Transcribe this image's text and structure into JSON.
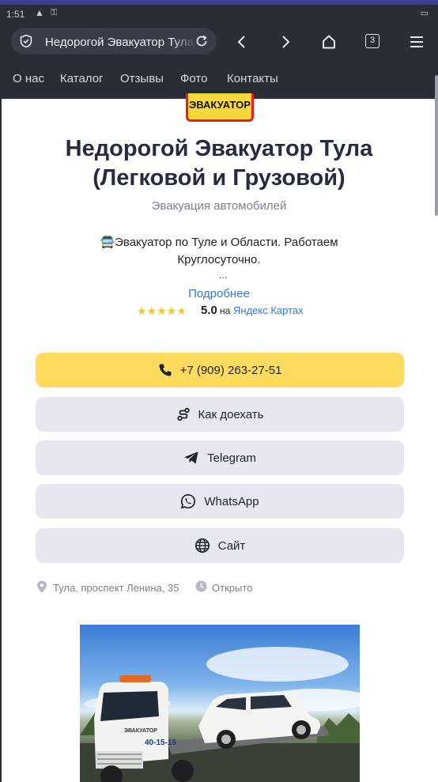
{
  "statusbar": {
    "time": "1:51"
  },
  "browser": {
    "url_text": "Недорогой Эвакуатор Тула",
    "tab_count": "3"
  },
  "nav": {
    "items": [
      "О нас",
      "Каталог",
      "Отзывы",
      "Фото",
      "Контакты"
    ]
  },
  "logo": {
    "text": "ЭВАКУАТОР"
  },
  "hero": {
    "title_line1": "Недорогой Эвакуатор Тула",
    "title_line2": "(Легковой и Грузовой)",
    "subtitle": "Эвакуация автомобилей",
    "description": "🚍Эвакуатор по Туле и Области. Работаем Круглосуточно.",
    "ellipsis": "...",
    "more_link": "Подробнее"
  },
  "rating": {
    "stars": "★★★★★",
    "value": 5.0,
    "value_text": "5.0",
    "on": "на",
    "source": "Яндекс Картах"
  },
  "buttons": {
    "phone": "+7 (909) 263-27-51",
    "route": "Как доехать",
    "telegram": "Telegram",
    "whatsapp": "WhatsApp",
    "site": "Сайт"
  },
  "info": {
    "address": "Тула, проспект Ленина, 35",
    "status": "Открыто"
  },
  "photo": {
    "truck_text": "ЭВАКУАТОР",
    "truck_number": "40-15-15"
  },
  "colors": {
    "chrome": "#2a2c36",
    "accent_yellow": "#fddb5c",
    "link_blue": "#2f7bd9",
    "button_gray": "#e6e7ef",
    "title_color": "#262b3f"
  }
}
